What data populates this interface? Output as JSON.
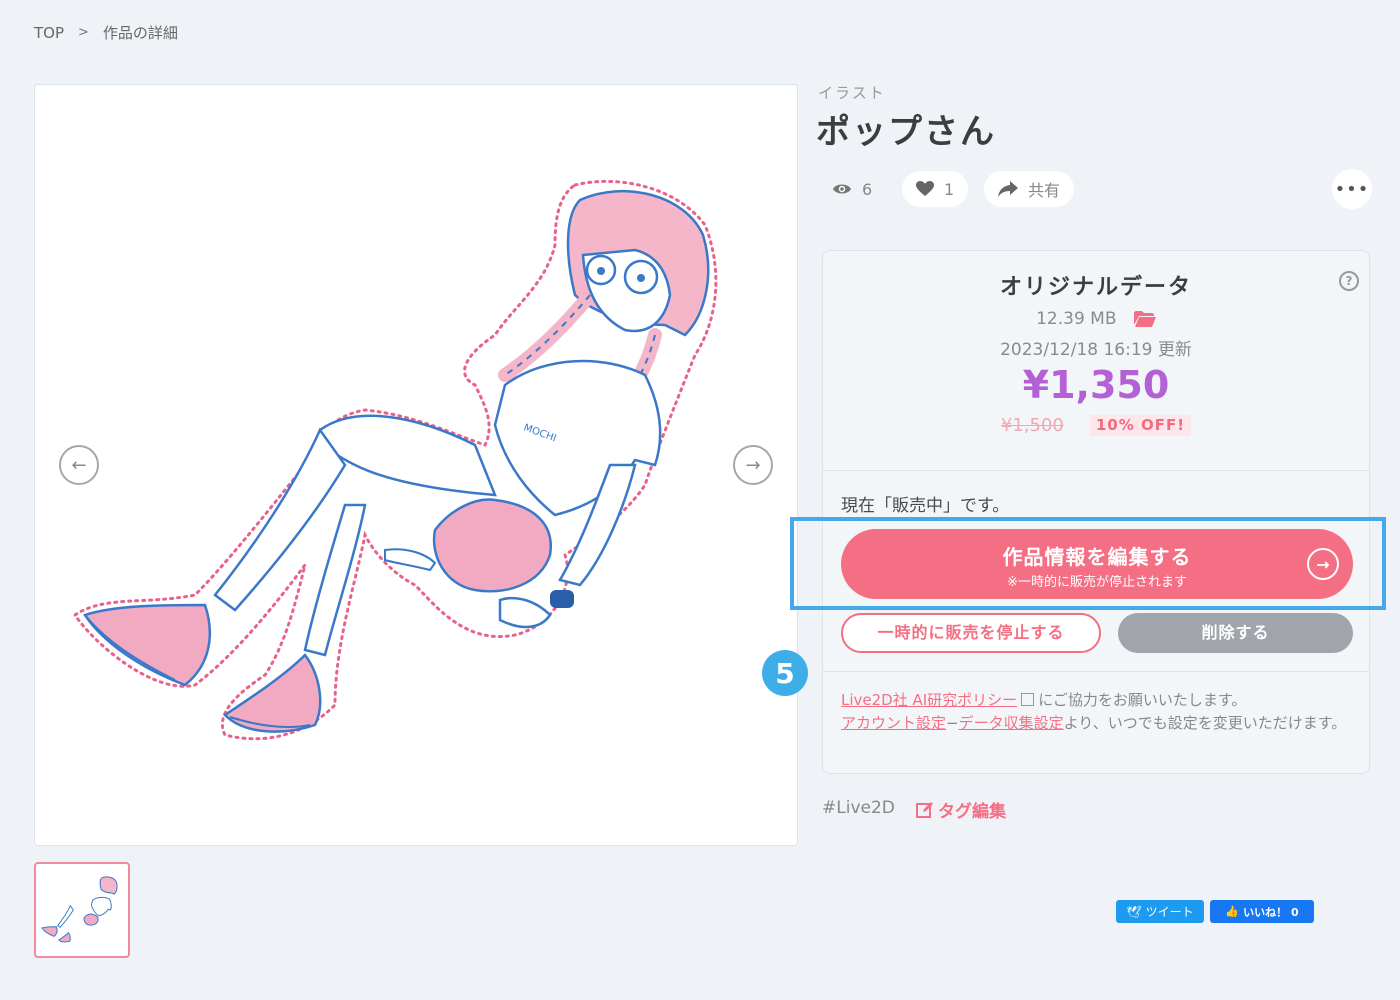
{
  "breadcrumb": {
    "top": "TOP",
    "separator": ">",
    "current": "作品の詳細"
  },
  "work": {
    "category": "イラスト",
    "title": "ポップさん"
  },
  "stats": {
    "views": "6",
    "likes": "1",
    "share_label": "共有",
    "more_label": "•••"
  },
  "data_card": {
    "title": "オリジナルデータ",
    "help_label": "?",
    "file_size": "12.39 MB",
    "updated": "2023/12/18 16:19 更新",
    "price": "¥1,350",
    "original_price": "¥1,500",
    "discount": "10% OFF!"
  },
  "status": {
    "text": "現在「販売中」です。"
  },
  "actions": {
    "edit_label": "作品情報を編集する",
    "edit_note": "※一時的に販売が停止されます",
    "stop_label": "一時的に販売を停止する",
    "delete_label": "削除する"
  },
  "annotation": {
    "step": "5"
  },
  "policy": {
    "link1": "Live2D社 AI研究ポリシー",
    "text1": "にご協力をお願いいたします。",
    "link2": "アカウント設定",
    "dash": "−",
    "link3": "データ収集設定",
    "text2": "より、いつでも設定を変更いただけます。"
  },
  "tags": {
    "tag1": "#Live2D",
    "edit_label": "タグ編集"
  },
  "social": {
    "tweet": "ツイート",
    "like": "いいね！ 0"
  },
  "colors": {
    "accent": "#f56f84",
    "price": "#b561d6",
    "highlight": "#45a8e8"
  },
  "icons": [
    "eye-icon",
    "heart-icon",
    "share-icon",
    "folder-icon",
    "help-icon",
    "arrow-left-icon",
    "arrow-right-icon",
    "external-link-icon",
    "edit-icon"
  ]
}
